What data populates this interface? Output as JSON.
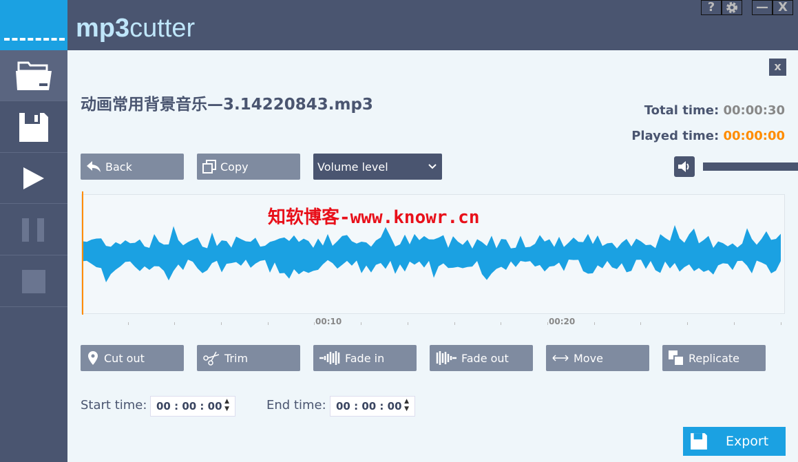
{
  "app": {
    "title_bold": "mp3",
    "title_rest": "cutter"
  },
  "window_controls": {
    "help": "?",
    "minimize": "—",
    "close": "X"
  },
  "sidebar": {
    "items": [
      {
        "name": "open-folder"
      },
      {
        "name": "save"
      },
      {
        "name": "play"
      },
      {
        "name": "pause",
        "disabled": true
      },
      {
        "name": "stop",
        "disabled": true
      }
    ]
  },
  "panel": {
    "close": "x",
    "filename": "动画常用背景音乐—3.14220843.mp3"
  },
  "times": {
    "total_label": "Total time:",
    "total_value": "00:00:30",
    "played_label": "Played time:",
    "played_value": "00:00:00"
  },
  "toolbar": {
    "back": "Back",
    "copy": "Copy",
    "volume_select": "Volume level"
  },
  "waveform": {
    "watermark": "知软博客-www.knowr.cn",
    "color": "#1ba1e2",
    "ticks": [
      "00:10",
      "00:20"
    ],
    "playhead_color": "#ff8c00"
  },
  "edit_buttons": [
    "Cut out",
    "Trim",
    "Fade in",
    "Fade out",
    "Move",
    "Replicate"
  ],
  "range": {
    "start_label": "Start time:",
    "start_value": "00 : 00 : 00",
    "end_label": "End time:",
    "end_value": "00 : 00 : 00"
  },
  "export": {
    "label": "Export",
    "color": "#1ba1e2"
  },
  "colors": {
    "sidebar": "#4a5570",
    "accent": "#1ba1e2",
    "played": "#ff8c00"
  }
}
